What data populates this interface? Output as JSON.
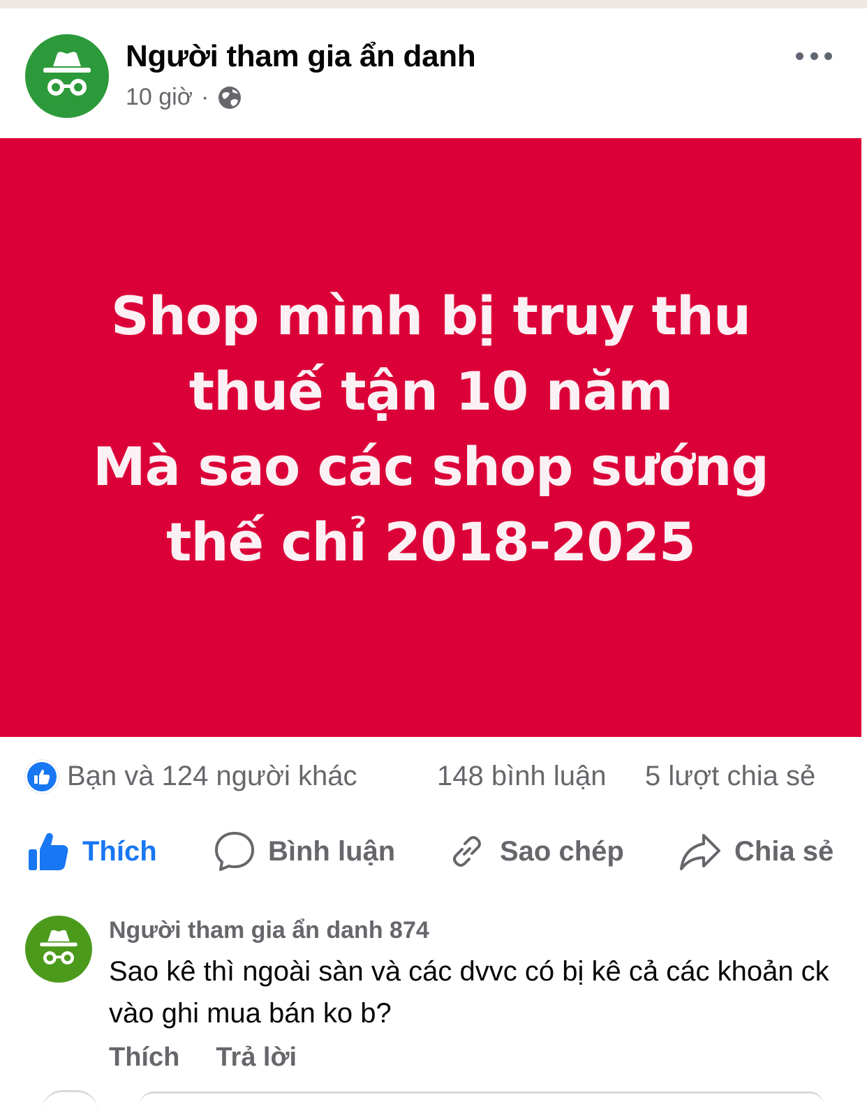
{
  "post": {
    "author": "Người tham gia ẩn danh",
    "time": "10 giờ",
    "separator": "·",
    "audience_icon": "globe-icon",
    "menu_icon": "more-options-icon"
  },
  "banner": {
    "background": "#dc0038",
    "text_color": "#fbf0f4",
    "lines": [
      "Shop mình bị truy thu",
      "thuế tận 10 năm",
      "Mà sao các shop sướng",
      "thế chỉ 2018-2025"
    ]
  },
  "stats": {
    "reactors": "Bạn và 124 người khác",
    "comments": "148 bình luận",
    "shares": "5 lượt chia sẻ"
  },
  "actions": {
    "like": "Thích",
    "comment": "Bình luận",
    "copy": "Sao chép",
    "share": "Chia sẻ",
    "active_color": "#1877f2"
  },
  "comment": {
    "author": "Người tham gia ẩn danh 874",
    "text": "Sao kê thì ngoài sàn và các dvvc có bị kê cả các khoản ck vào ghi mua bán ko b?",
    "like": "Thích",
    "reply": "Trả lời"
  }
}
